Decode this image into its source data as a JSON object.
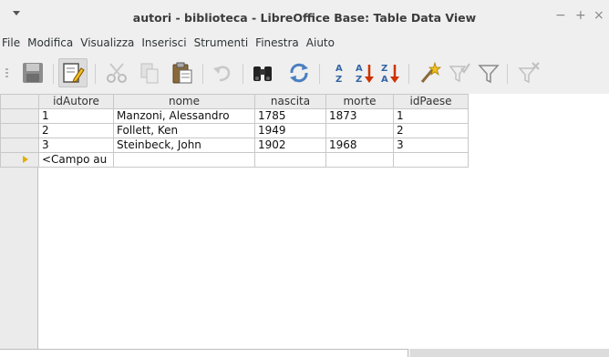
{
  "window": {
    "title": "autori - biblioteca - LibreOffice Base: Table Data View",
    "controls": {
      "minimize": "−",
      "maximize": "+",
      "close": "×"
    }
  },
  "menu": {
    "items": [
      "File",
      "Modifica",
      "Visualizza",
      "Inserisci",
      "Strumenti",
      "Finestra",
      "Aiuto"
    ]
  },
  "toolbar": {
    "buttons": [
      {
        "name": "save",
        "icon": "save-icon",
        "active": false
      },
      {
        "name": "edit-data",
        "icon": "edit-icon",
        "active": true
      },
      {
        "name": "cut",
        "icon": "cut-icon",
        "active": false
      },
      {
        "name": "copy",
        "icon": "copy-icon",
        "active": false
      },
      {
        "name": "paste",
        "icon": "paste-icon",
        "active": false
      },
      {
        "name": "undo",
        "icon": "undo-icon",
        "active": false
      },
      {
        "name": "find",
        "icon": "binoculars-icon",
        "active": false
      },
      {
        "name": "refresh",
        "icon": "refresh-icon",
        "active": false
      },
      {
        "name": "sort-asc",
        "icon": "sort-ascending-icon",
        "active": false
      },
      {
        "name": "sort-asc-2",
        "icon": "sort-ascending-icon",
        "active": false
      },
      {
        "name": "sort-desc",
        "icon": "sort-descending-icon",
        "active": false
      },
      {
        "name": "autofilter",
        "icon": "autofilter-icon",
        "active": false
      },
      {
        "name": "apply-filter",
        "icon": "apply-filter-icon",
        "active": false
      },
      {
        "name": "standard-filter",
        "icon": "standard-filter-icon",
        "active": false
      },
      {
        "name": "remove-filter",
        "icon": "remove-filter-icon",
        "active": false
      }
    ],
    "sort_labels": {
      "a": "A",
      "z": "Z"
    }
  },
  "table": {
    "columns": [
      "idAutore",
      "nome",
      "nascita",
      "morte",
      "idPaese"
    ],
    "rows": [
      [
        "1",
        "Manzoni, Alessandro",
        "1785",
        "1873",
        "1"
      ],
      [
        "2",
        "Follett, Ken",
        "1949",
        "",
        "2"
      ],
      [
        "3",
        "Steinbeck, John",
        "1902",
        "1968",
        "3"
      ]
    ],
    "new_row": [
      "<Campo au",
      "",
      "",
      "",
      ""
    ]
  },
  "colors": {
    "accent_yellow": "#e0b000",
    "sort_blue": "#3465a4",
    "sort_red": "#cc3300"
  }
}
